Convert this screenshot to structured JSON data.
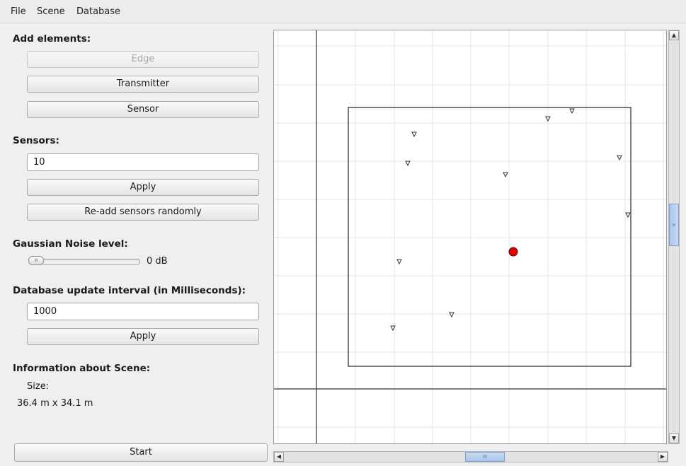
{
  "menu": {
    "file": "File",
    "scene": "Scene",
    "database": "Database"
  },
  "add_elements": {
    "label": "Add elements:",
    "edge_button": "Edge",
    "transmitter_button": "Transmitter",
    "sensor_button": "Sensor"
  },
  "sensors": {
    "label": "Sensors:",
    "count_value": "10",
    "apply_button": "Apply",
    "readd_button": "Re-add sensors randomly"
  },
  "noise": {
    "label": "Gaussian Noise level:",
    "value_text": "0 dB",
    "slider_level": 0
  },
  "database": {
    "label": "Database update interval (in Milliseconds):",
    "interval_value": "1000",
    "apply_button": "Apply"
  },
  "scene_info": {
    "label": "Information about Scene:",
    "size_label": "Size:",
    "size_value": "36.4 m x 34.1 m"
  },
  "start_button": "Start",
  "colors": {
    "transmitter": "#e00000",
    "grid": "#e4e4e4",
    "accent": "#a9c6ec"
  }
}
